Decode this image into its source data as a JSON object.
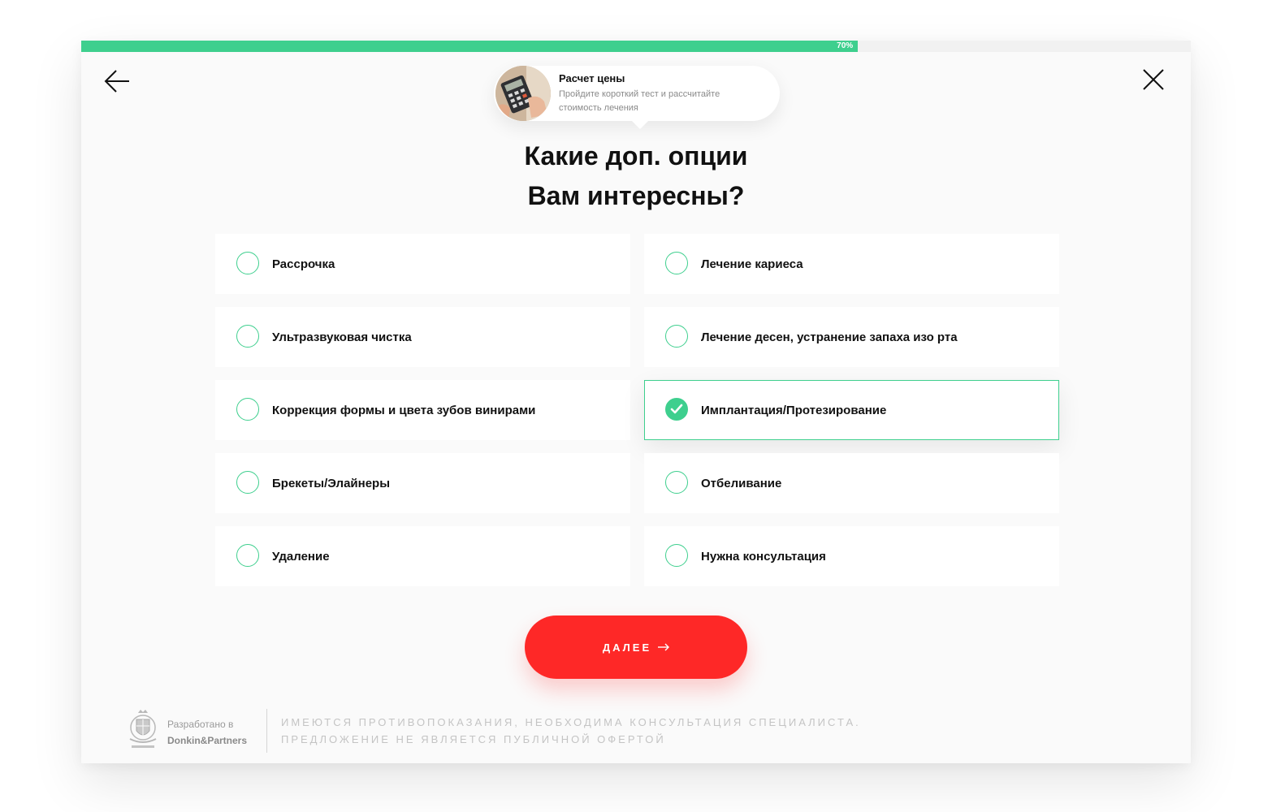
{
  "progress": {
    "percent": 70,
    "label": "70%",
    "color": "#3ecf8e"
  },
  "nav": {
    "back_icon": "arrow-left-icon",
    "close_icon": "close-icon"
  },
  "intro": {
    "title": "Расчет цены",
    "subtitle": "Пройдите короткий тест и рассчитайте стоимость лечения"
  },
  "question": {
    "line1": "Какие доп. опции",
    "line2": "Вам интересны?"
  },
  "options": [
    {
      "label": "Рассрочка",
      "selected": false
    },
    {
      "label": "Лечение кариеса",
      "selected": false
    },
    {
      "label": "Ультразвуковая чистка",
      "selected": false
    },
    {
      "label": "Лечение десен, устранение запаха изо рта",
      "selected": false
    },
    {
      "label": "Коррекция формы и цвета зубов винирами",
      "selected": false
    },
    {
      "label": "Имплантация/Протезирование",
      "selected": true
    },
    {
      "label": "Брекеты/Элайнеры",
      "selected": false
    },
    {
      "label": "Отбеливание",
      "selected": false
    },
    {
      "label": "Удаление",
      "selected": false
    },
    {
      "label": "Нужна консультация",
      "selected": false
    }
  ],
  "next_button": {
    "label": "ДАЛЕЕ",
    "color": "#fe2827"
  },
  "footer": {
    "developed_prefix": "Разработано в",
    "developer": "Donkin&Partners",
    "disclaimer_line1": "ИМЕЮТСЯ ПРОТИВОПОКАЗАНИЯ, НЕОБХОДИМА КОНСУЛЬТАЦИЯ СПЕЦИАЛИСТА.",
    "disclaimer_line2": "ПРЕДЛОЖЕНИЕ НЕ ЯВЛЯЕТСЯ ПУБЛИЧНОЙ ОФЕРТОЙ"
  }
}
